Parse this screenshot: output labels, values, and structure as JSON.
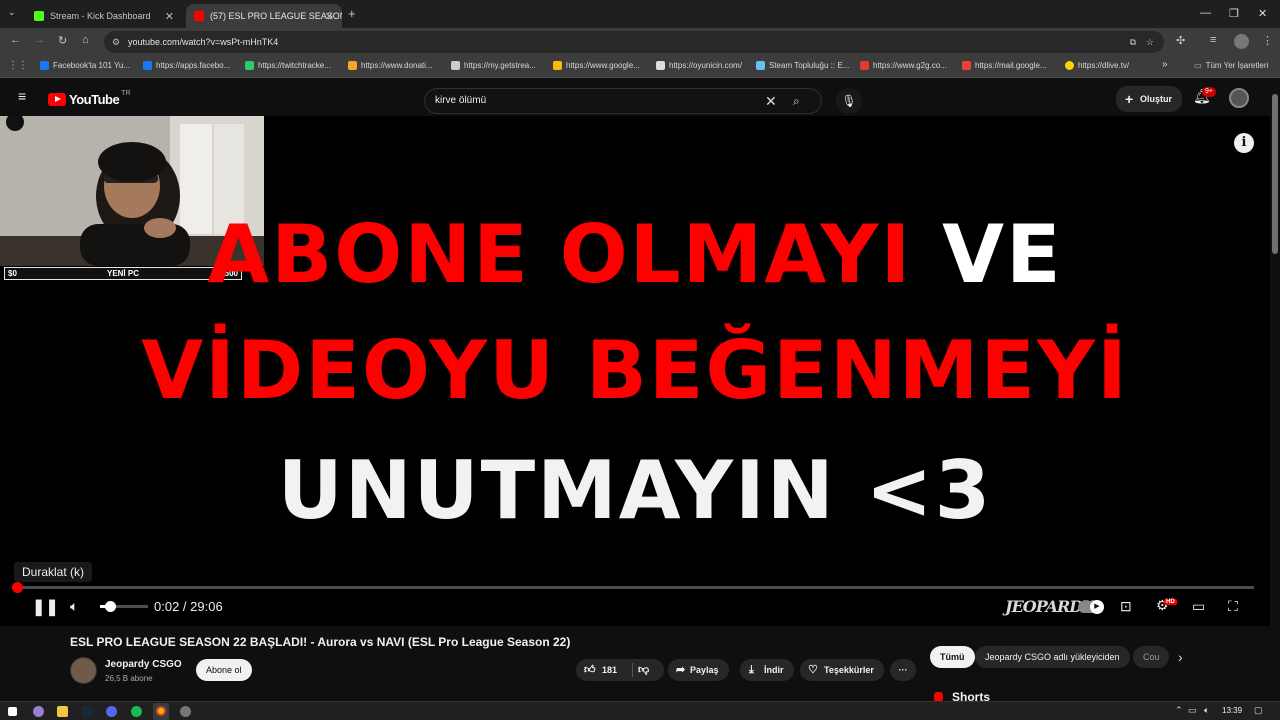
{
  "browser": {
    "tabs": [
      {
        "label": "Stream - Kick Dashboard",
        "active": false,
        "favicon_color": "#53fc18"
      },
      {
        "label": "(57) ESL PRO LEAGUE SEASON",
        "active": true,
        "favicon_color": "#ff0000"
      }
    ],
    "new_tab_label": "+",
    "url": "youtube.com/watch?v=wsPt-mHnTK4",
    "bookmarks": [
      {
        "label": "Facebook'ta 101 Yu...",
        "color": "#1877f2"
      },
      {
        "label": "https://apps.facebo...",
        "color": "#1877f2"
      },
      {
        "label": "https://twitchtracke...",
        "color": "#2ecc71"
      },
      {
        "label": "https://www.donati...",
        "color": "#f5a623"
      },
      {
        "label": "https://my.getstrea...",
        "color": "#cccccc"
      },
      {
        "label": "https://www.google...",
        "color": "#fbbc05"
      },
      {
        "label": "https://oyunicin.com/",
        "color": "#dddddd"
      },
      {
        "label": "Steam Topluluğu :: E...",
        "color": "#66c0f4"
      },
      {
        "label": "https://www.g2g.co...",
        "color": "#e53935"
      },
      {
        "label": "https://mail.google...",
        "color": "#ea4335"
      },
      {
        "label": "https://dlive.tv/",
        "color": "#ffd300"
      }
    ],
    "bookmarks_more": "»",
    "all_bookmarks_label": "Tüm Yer İşaretleri"
  },
  "youtube": {
    "logo_text": "YouTube",
    "logo_region": "TR",
    "search_value": "kirve ölümü",
    "create_label": "Oluştur",
    "notification_badge": "9+",
    "brand_color": "#ff0000"
  },
  "video": {
    "lines": [
      {
        "segments": [
          {
            "text": "ABONE OLMAYI ",
            "color": "#ff0000"
          },
          {
            "text": "VE",
            "color": "#ffffff"
          }
        ]
      },
      {
        "segments": [
          {
            "text": "VİDEOYU BEĞENMEYİ",
            "color": "#ff0000"
          }
        ]
      },
      {
        "segments": [
          {
            "text": "UNUTMAYIN <3",
            "color": "#f2f2f2"
          }
        ]
      }
    ],
    "webcam_hud": {
      "left": "$0",
      "center": "YENİ PC",
      "right": "$1500"
    },
    "tooltip": "Duraklat (k)",
    "time_current": "0:02",
    "time_separator": " / ",
    "time_total": "29:06",
    "progress_fraction": 0.0011,
    "volume_fraction": 0.2,
    "channel_watermark": "JEOPARDY",
    "hd_badge": "HD"
  },
  "details": {
    "title": "ESL PRO LEAGUE SEASON 22 BAŞLADI! - Aurora vs NAVI (ESL Pro League Season 22)",
    "channel_name": "Jeopardy CSGO",
    "subscribers": "26,5 B abone",
    "subscribe_label": "Abone ol",
    "likes": "181",
    "share_label": "Paylaş",
    "download_label": "İndir",
    "thanks_label": "Teşekkürler",
    "more_label": "···"
  },
  "sidebar": {
    "chips": [
      "Tümü",
      "Jeopardy CSGO adlı yükleyiciden",
      "Cou"
    ],
    "shorts_label": "Shorts"
  },
  "taskbar": {
    "time": "13:39"
  }
}
